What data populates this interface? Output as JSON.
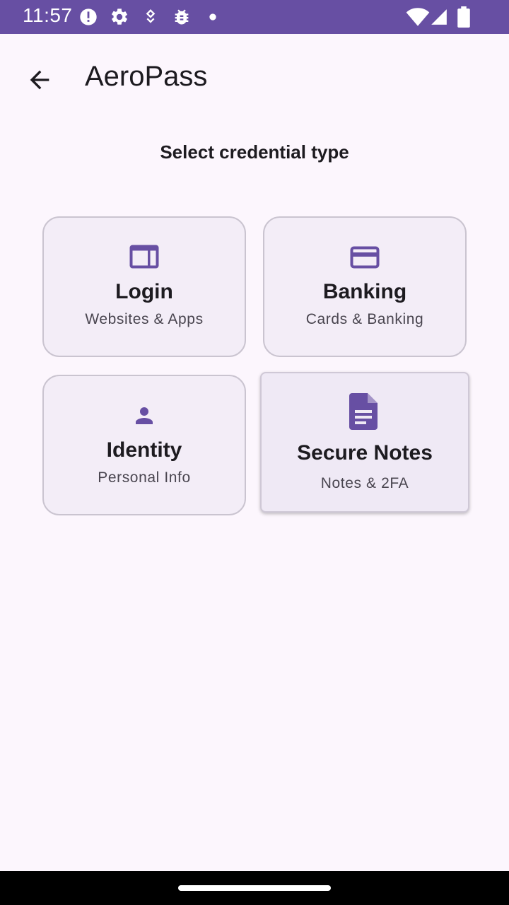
{
  "status_bar": {
    "time": "11:57",
    "icons": [
      "alert-icon",
      "settings-icon",
      "location-icon",
      "bug-icon",
      "dot-icon",
      "wifi-icon",
      "signal-icon",
      "battery-icon"
    ]
  },
  "app_bar": {
    "title": "AeroPass",
    "back_icon": "arrow-back-icon"
  },
  "section_title": "Select credential type",
  "cards": [
    {
      "icon": "browser-window-icon",
      "title": "Login",
      "subtitle": "Websites & Apps"
    },
    {
      "icon": "credit-card-icon",
      "title": "Banking",
      "subtitle": "Cards & Banking"
    },
    {
      "icon": "person-icon",
      "title": "Identity",
      "subtitle": "Personal Info"
    },
    {
      "icon": "note-icon",
      "title": "Secure Notes",
      "subtitle": "Notes & 2FA",
      "selected": true
    }
  ],
  "colors": {
    "accent": "#674fa3",
    "status_bar": "#674fa3",
    "background": "#fcf6fd",
    "card": "#f3edf7"
  }
}
